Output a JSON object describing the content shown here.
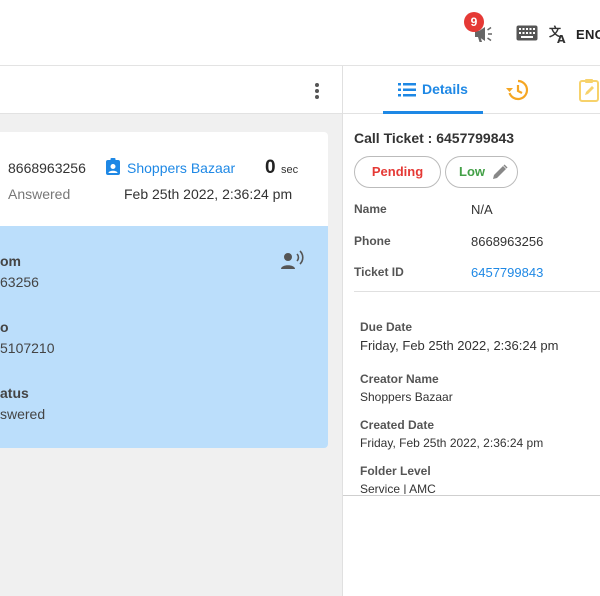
{
  "topbar": {
    "notification_count": "9",
    "language": "ENG",
    "icons": [
      "megaphone-icon",
      "keyboard-icon",
      "translate-icon"
    ]
  },
  "call_card": {
    "phone": "8668963256",
    "status": "Answered",
    "contact_name": "Shoppers Bazaar",
    "duration": "0",
    "duration_unit": "sec",
    "date": "Feb 25th 2022, 2:36:24 pm"
  },
  "call_detail": {
    "from_label": "om",
    "from_value": "63256",
    "to_label": "o",
    "to_value": "5107210",
    "status_label": "atus",
    "status_value": "swered"
  },
  "right_panel": {
    "tabs": [
      {
        "label": "Details",
        "icon": "list-icon",
        "active": true
      },
      {
        "label": "",
        "icon": "history-icon",
        "active": false
      },
      {
        "label": "",
        "icon": "note-icon",
        "active": false
      }
    ],
    "ticket_title": "Call Ticket : 6457799843",
    "status_pill": "Pending",
    "priority_pill": "Low",
    "fields": {
      "name_label": "Name",
      "name_value": "N/A",
      "phone_label": "Phone",
      "phone_value": "8668963256",
      "ticket_id_label": "Ticket ID",
      "ticket_id_value": "6457799843"
    },
    "info": {
      "due_date_label": "Due Date",
      "due_date_value": "Friday, Feb 25th 2022, 2:36:24 pm",
      "creator_label": "Creator Name",
      "creator_value": "Shoppers Bazaar",
      "created_label": "Created Date",
      "created_value": "Friday, Feb 25th 2022, 2:36:24 pm",
      "folder_label": "Folder Level",
      "folder_value": "Service | AMC"
    }
  },
  "colors": {
    "accent": "#1e88e5",
    "pending": "#e53935",
    "low": "#43a047",
    "detail_card": "#bbdefb",
    "badge": "#e53935"
  }
}
